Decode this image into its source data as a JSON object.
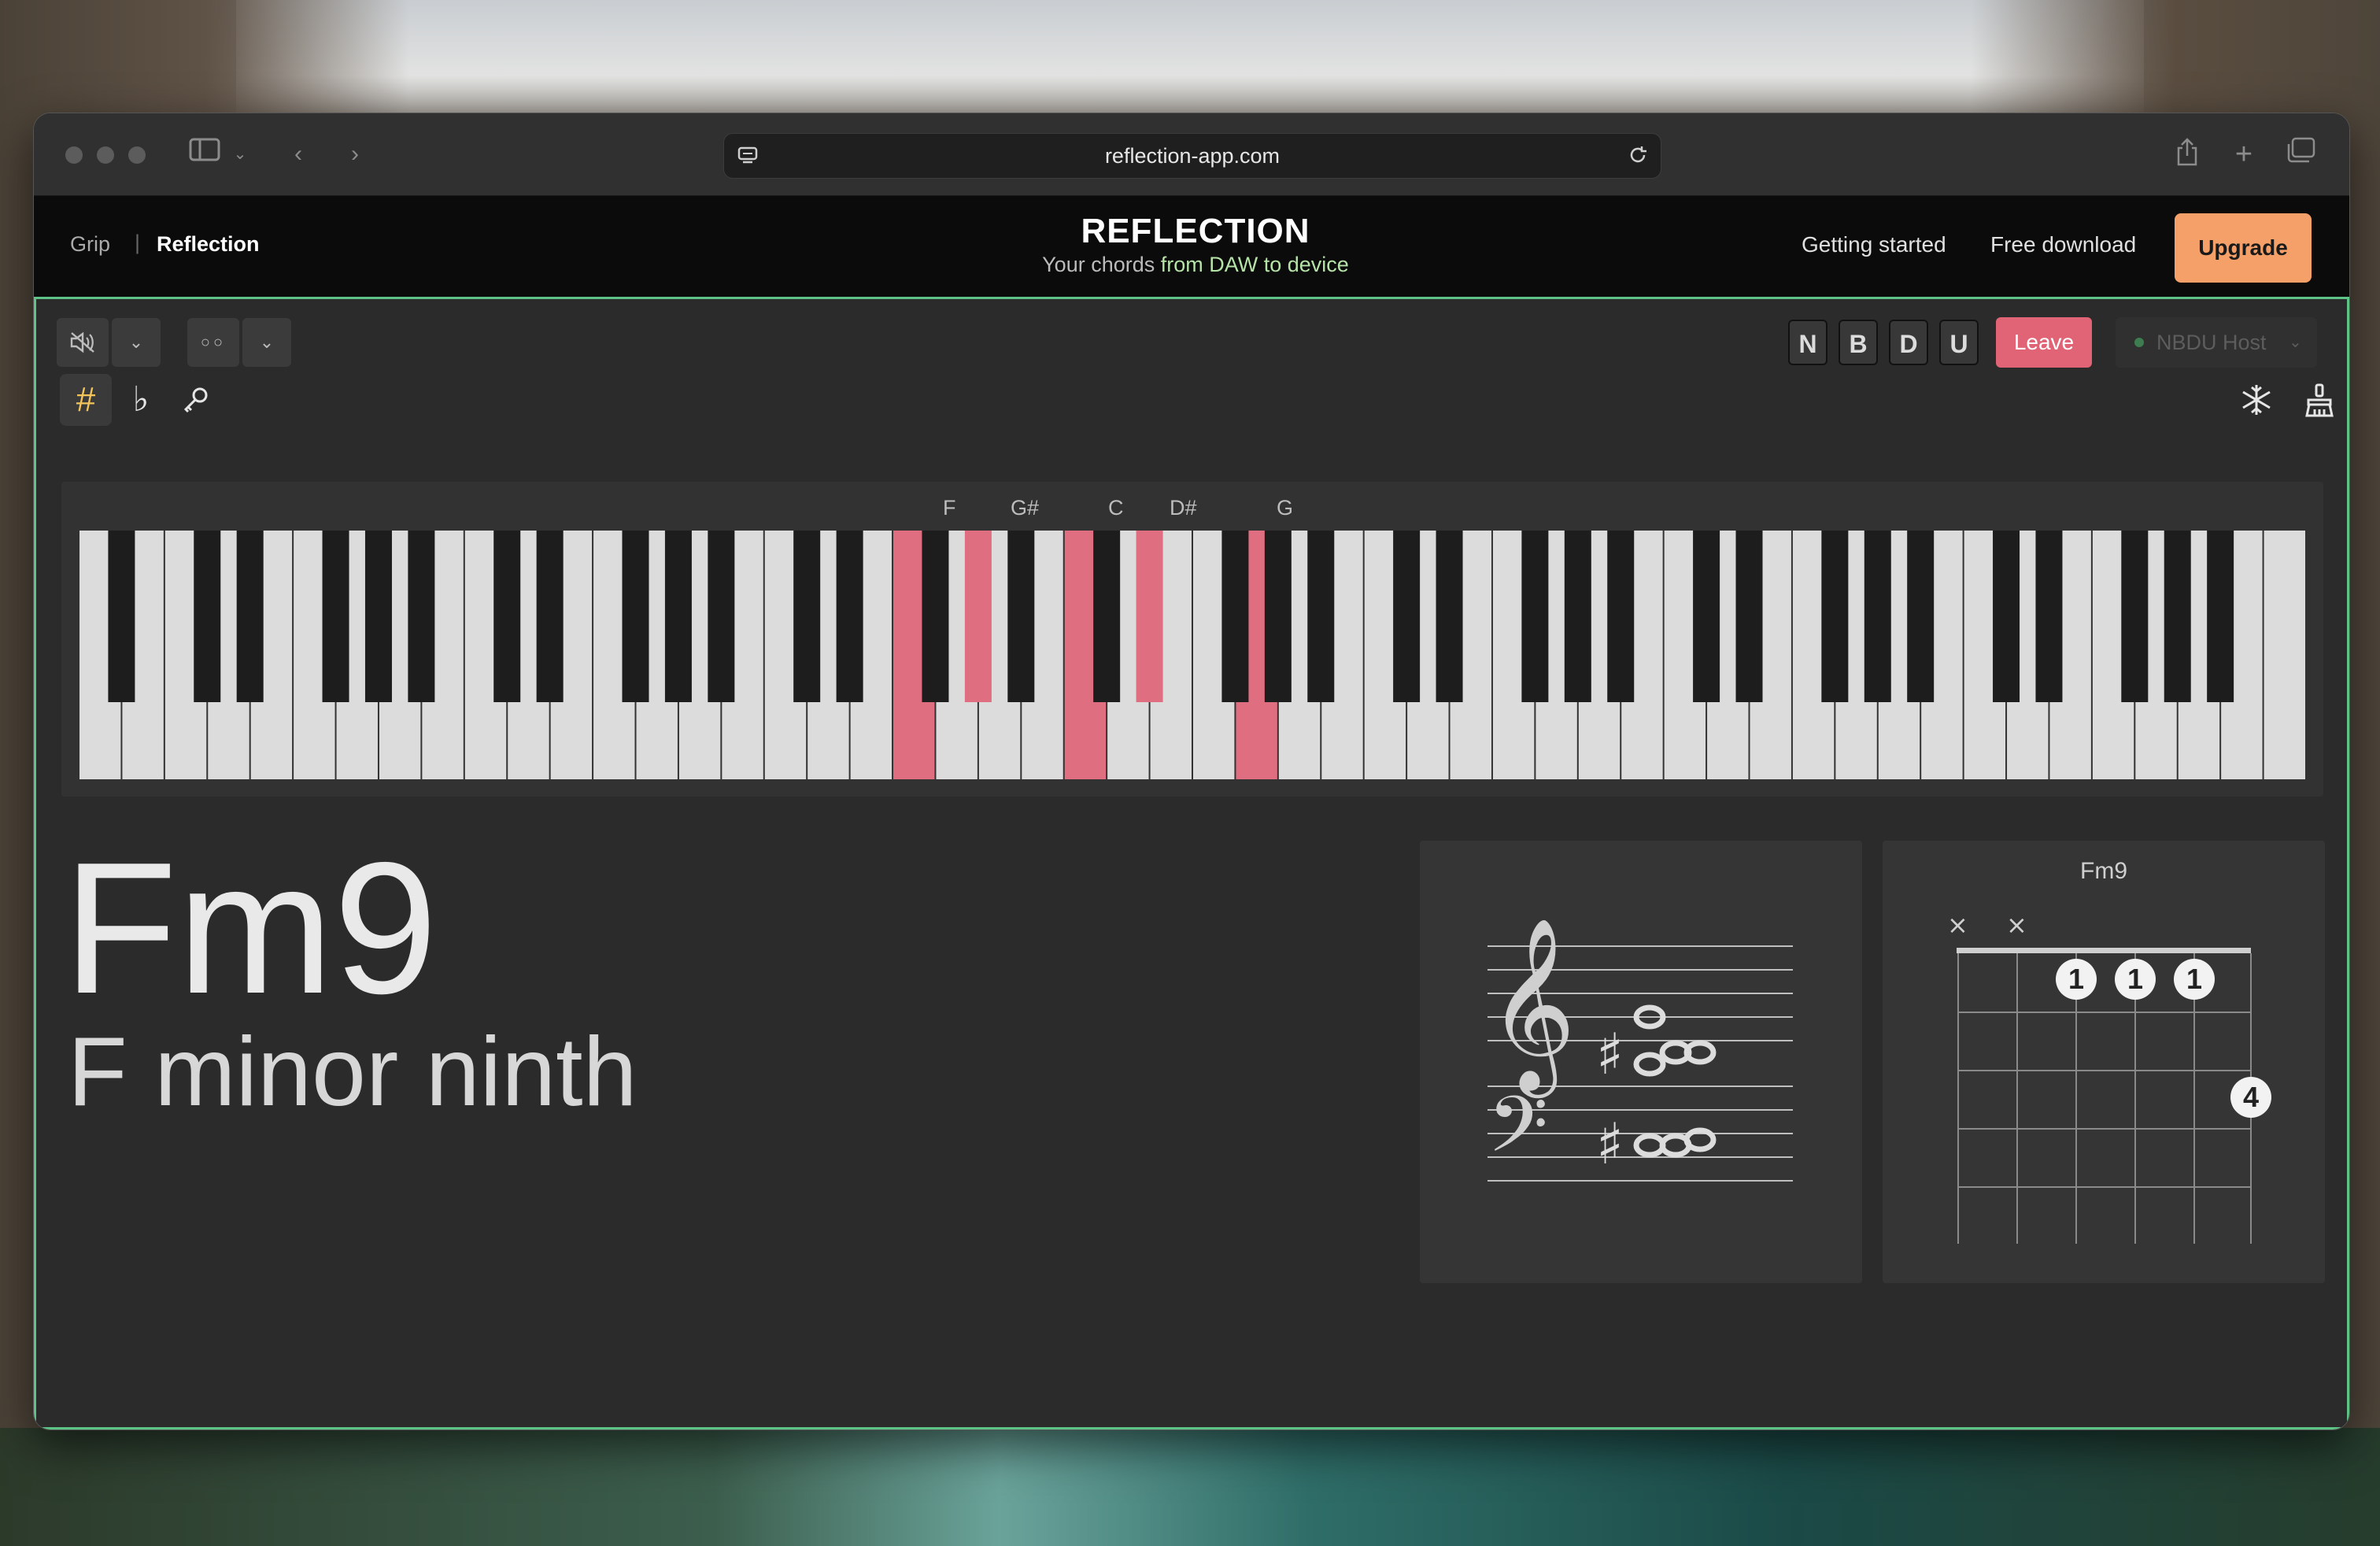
{
  "browser": {
    "url": "reflection-app.com"
  },
  "header": {
    "nav_grip": "Grip",
    "nav_separator": "|",
    "nav_reflection": "Reflection",
    "brand_title": "REFLECTION",
    "brand_sub_prefix": "Your chords ",
    "brand_sub_highlight": "from DAW to device",
    "link_getting_started": "Getting started",
    "link_free_download": "Free download",
    "upgrade_label": "Upgrade"
  },
  "controls": {
    "letters": [
      "N",
      "B",
      "D",
      "U"
    ],
    "leave_label": "Leave",
    "host_label": "NBDU Host",
    "sharp_symbol": "#",
    "flat_symbol": "♭"
  },
  "piano": {
    "white_key_count": 52,
    "pressed_labels": [
      "F",
      "G#",
      "C",
      "D#",
      "G"
    ],
    "pressed_notes": [
      "F3",
      "G#3",
      "C4",
      "D#4",
      "G4"
    ],
    "highlight_color": "#df6f80"
  },
  "chord": {
    "symbol": "Fm9",
    "name": "F minor ninth"
  },
  "guitar": {
    "title": "Fm9",
    "muted_marks": [
      "×",
      "×"
    ],
    "fingers": [
      "1",
      "1",
      "1",
      "4"
    ]
  },
  "colors": {
    "accent_green": "#5ec387",
    "upgrade_orange": "#f4a068",
    "leave_red": "#e06475"
  }
}
